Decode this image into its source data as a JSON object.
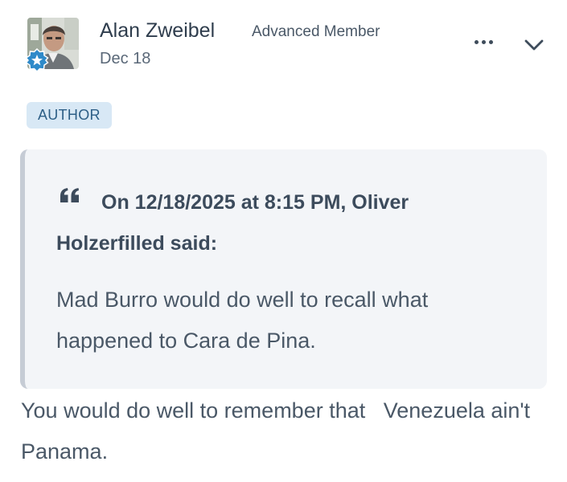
{
  "post": {
    "author": {
      "name": "Alan Zweibel",
      "title": "Advanced Member",
      "date": "Dec 18",
      "badge_label": "AUTHOR",
      "avatar_icon": "user-photo",
      "rank_icon": "star-badge-icon"
    },
    "actions": {
      "more_icon": "ellipsis-icon",
      "expand_icon": "chevron-down-icon"
    },
    "quote": {
      "icon": "quote-marks-icon",
      "citation": "On 12/18/2025 at 8:15 PM, Oliver Holzerfilled said:",
      "body": "Mad Burro would do well to recall what happened to Cara de Pina."
    },
    "reply": "You would do well to remember that   Venezuela ain't Panama."
  },
  "colors": {
    "badge_bg": "#d8e8f5",
    "badge_text": "#2c5e86",
    "quote_bg": "#f3f5f8",
    "quote_border": "#c6ccd5",
    "rank_badge": "#2f8ac9"
  }
}
